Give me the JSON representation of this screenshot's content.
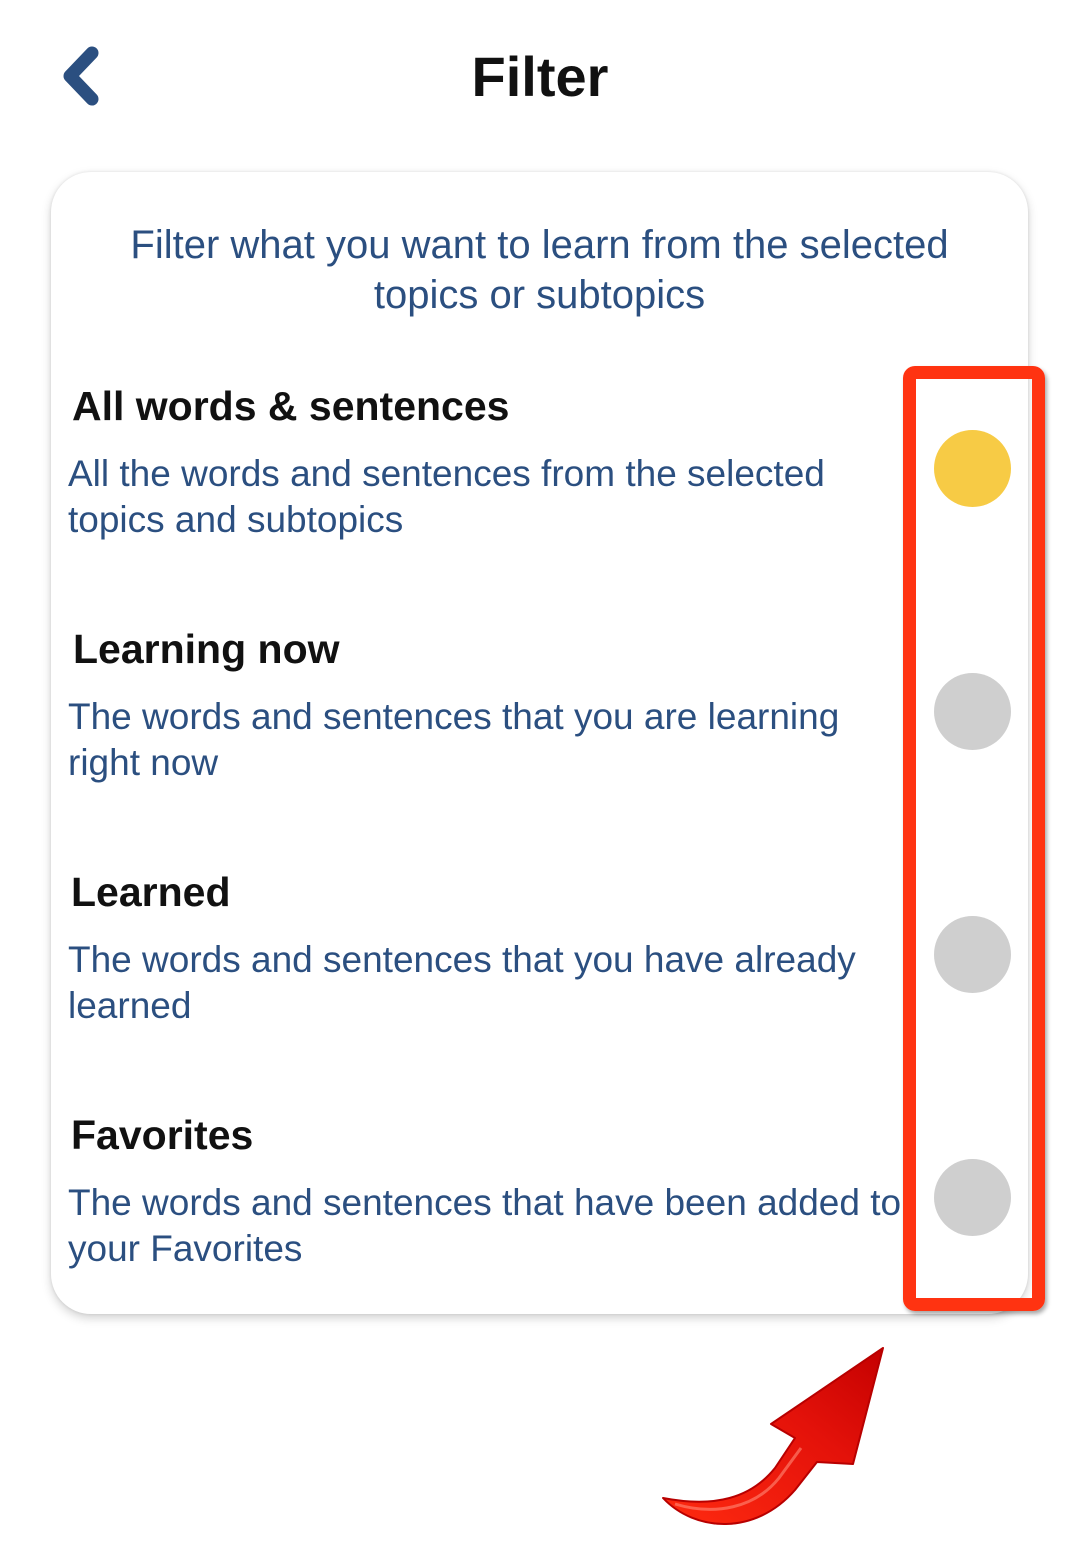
{
  "header": {
    "back_icon": "chevron-left-icon",
    "title": "Filter"
  },
  "card": {
    "intro": "Filter what you want to learn from the selected topics or subtopics",
    "options": [
      {
        "title": "All words & sentences",
        "description": "All the words and sentences from the selected topics and subtopics",
        "selected": true
      },
      {
        "title": "Learning now",
        "description": "The words and sentences that you are learning right now",
        "selected": false
      },
      {
        "title": "Learned",
        "description": "The words and sentences that you have already learned",
        "selected": false
      },
      {
        "title": "Favorites",
        "description": "The words and sentences that have been added to your Favorites",
        "selected": false
      }
    ]
  },
  "colors": {
    "accent_blue": "#2b4f80",
    "selected_radio": "#f7cb45",
    "unselected_radio": "#cfcfcf",
    "annotation_red": "#ff3311"
  }
}
